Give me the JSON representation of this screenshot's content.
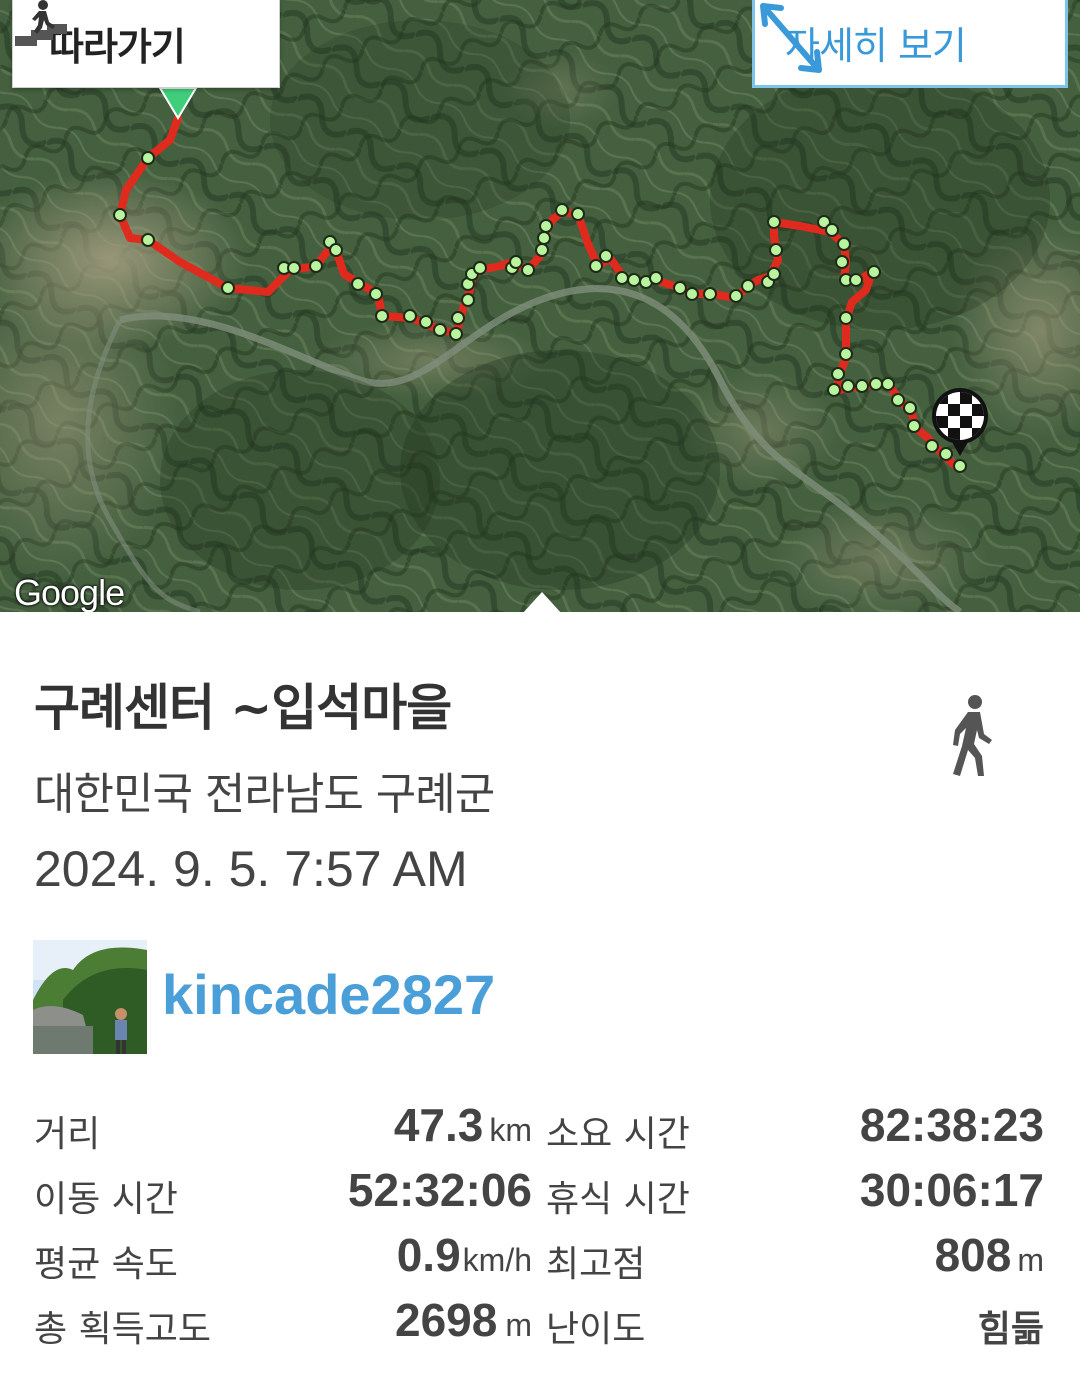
{
  "map": {
    "follow_label": "따라가기",
    "detail_label": "자세히 보기",
    "provider_logo": "Google",
    "icons": {
      "follow": "hiker-stairs-icon",
      "detail": "expand-arrows-icon",
      "start": "start-marker-icon",
      "end": "finish-flag-icon"
    },
    "route_color": "#e02a1e",
    "waypoint_color": "#b9f59e"
  },
  "track": {
    "title": "구례센터 ~입석마을",
    "location": "대한민국 전라남도 구례군",
    "datetime": "2024. 9. 5. 7:57 AM",
    "activity_icon": "walking-person-icon",
    "user": {
      "name": "kincade2827",
      "avatar": "hiker-photo-avatar"
    },
    "name_color": "#4a9fd8"
  },
  "stats": {
    "distance": {
      "label": "거리",
      "value": "47.3",
      "unit": "km"
    },
    "total_time": {
      "label": "소요 시간",
      "value": "82:38:23"
    },
    "moving_time": {
      "label": "이동 시간",
      "value": "52:32:06"
    },
    "rest_time": {
      "label": "휴식 시간",
      "value": "30:06:17"
    },
    "avg_speed": {
      "label": "평균 속도",
      "value": "0.9",
      "unit": "km/h"
    },
    "max_elevation": {
      "label": "최고점",
      "value": "808",
      "unit": "m"
    },
    "total_ascent": {
      "label": "총 획득고도",
      "value": "2698",
      "unit": "m"
    },
    "difficulty": {
      "label": "난이도",
      "value": "힘듦"
    }
  }
}
